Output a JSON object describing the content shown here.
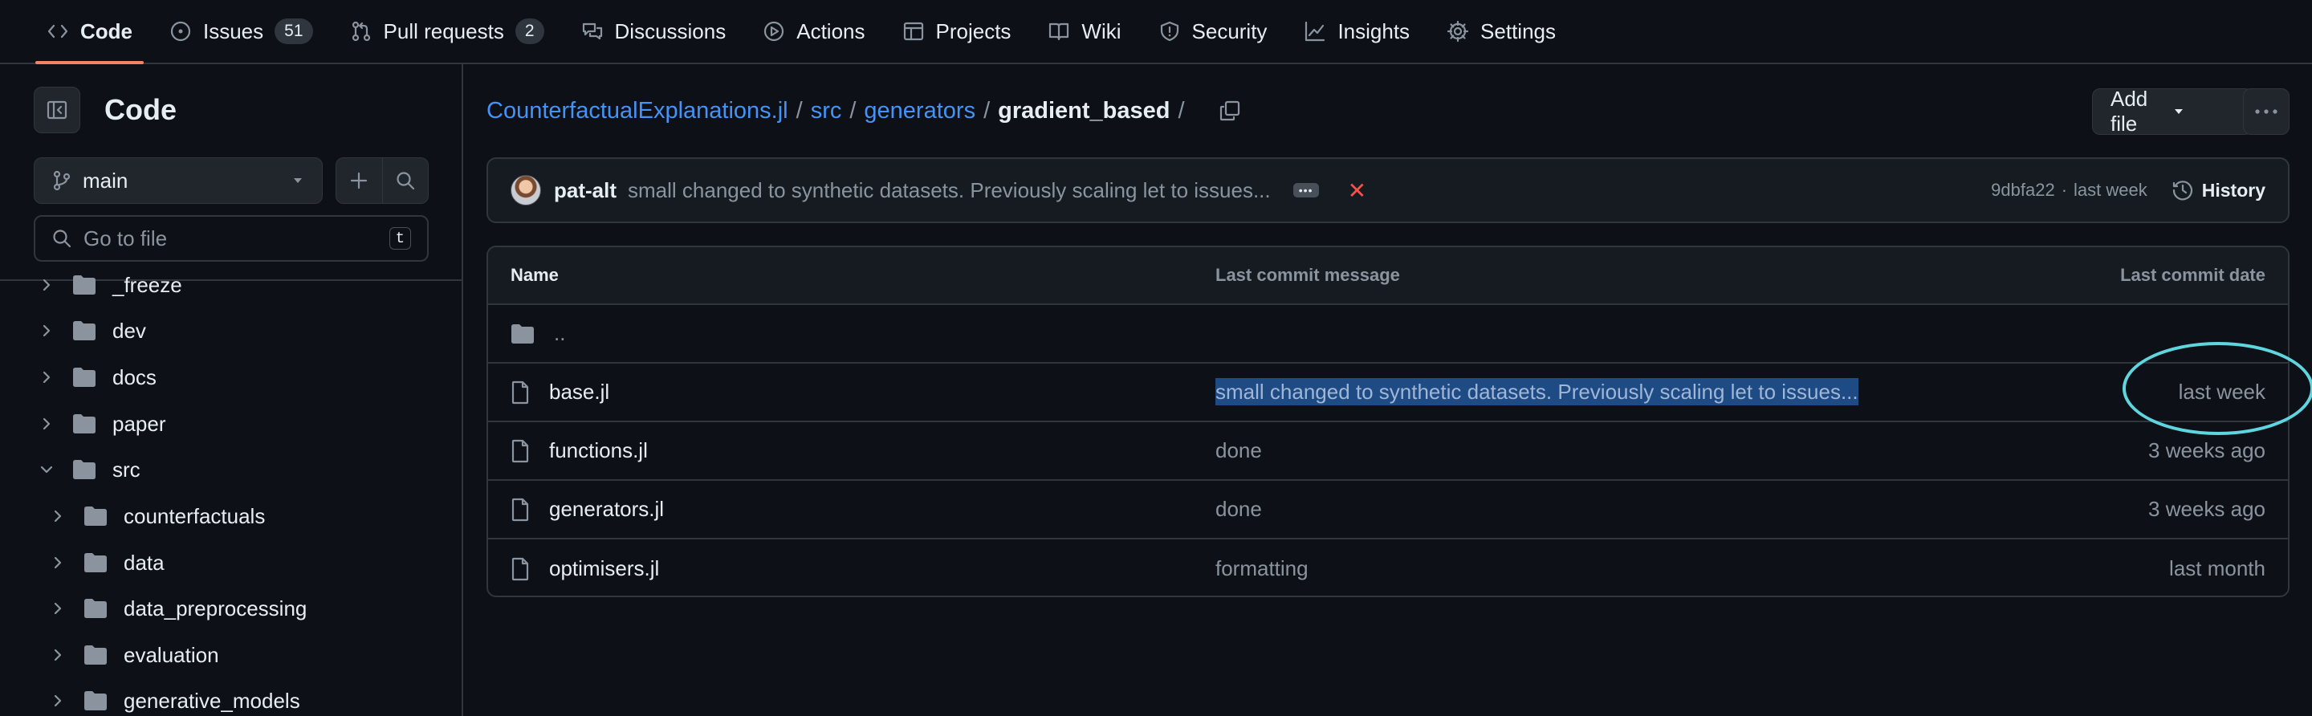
{
  "topnav": {
    "tabs": [
      {
        "label": "Code",
        "icon": "code-icon",
        "active": true
      },
      {
        "label": "Issues",
        "icon": "issue-icon",
        "count": "51"
      },
      {
        "label": "Pull requests",
        "icon": "pull-request-icon",
        "count": "2"
      },
      {
        "label": "Discussions",
        "icon": "discussions-icon"
      },
      {
        "label": "Actions",
        "icon": "play-icon"
      },
      {
        "label": "Projects",
        "icon": "table-icon"
      },
      {
        "label": "Wiki",
        "icon": "book-icon"
      },
      {
        "label": "Security",
        "icon": "shield-icon"
      },
      {
        "label": "Insights",
        "icon": "graph-icon"
      },
      {
        "label": "Settings",
        "icon": "gear-icon"
      }
    ]
  },
  "sidebar": {
    "title": "Code",
    "branch": "main",
    "goto_placeholder": "Go to file",
    "goto_shortcut": "t",
    "tree": [
      {
        "label": "_freeze",
        "expanded": false
      },
      {
        "label": "dev",
        "expanded": false
      },
      {
        "label": "docs",
        "expanded": false
      },
      {
        "label": "paper",
        "expanded": false
      },
      {
        "label": "src",
        "expanded": true
      },
      {
        "label": "counterfactuals",
        "expanded": false
      },
      {
        "label": "data",
        "expanded": false
      },
      {
        "label": "data_preprocessing",
        "expanded": false
      },
      {
        "label": "evaluation",
        "expanded": false
      },
      {
        "label": "generative_models",
        "expanded": false
      }
    ]
  },
  "breadcrumb": {
    "repo": "CounterfactualExplanations.jl",
    "parts": [
      "src",
      "generators"
    ],
    "current": "gradient_based",
    "separator": "/"
  },
  "actions": {
    "add_file": "Add file"
  },
  "latest_commit": {
    "author": "pat-alt",
    "message": "small changed to synthetic datasets. Previously scaling let to issues...",
    "status": "✕",
    "hash": "9dbfa22",
    "dot": "·",
    "time": "last week",
    "history": "History"
  },
  "table": {
    "headers": {
      "name": "Name",
      "message": "Last commit message",
      "date": "Last commit date"
    },
    "parent": "..",
    "rows": [
      {
        "name": "base.jl",
        "message": "small changed to synthetic datasets. Previously scaling let to issues...",
        "date": "last week"
      },
      {
        "name": "functions.jl",
        "message": "done",
        "date": "3 weeks ago"
      },
      {
        "name": "generators.jl",
        "message": "done",
        "date": "3 weeks ago"
      },
      {
        "name": "optimisers.jl",
        "message": "formatting",
        "date": "last month"
      }
    ]
  },
  "colors": {
    "background": "#0d1117",
    "accent_link": "#4493f8",
    "active_tab_underline": "#f78166",
    "annotation_circle": "#5fd6de",
    "status_fail": "#f85149"
  }
}
